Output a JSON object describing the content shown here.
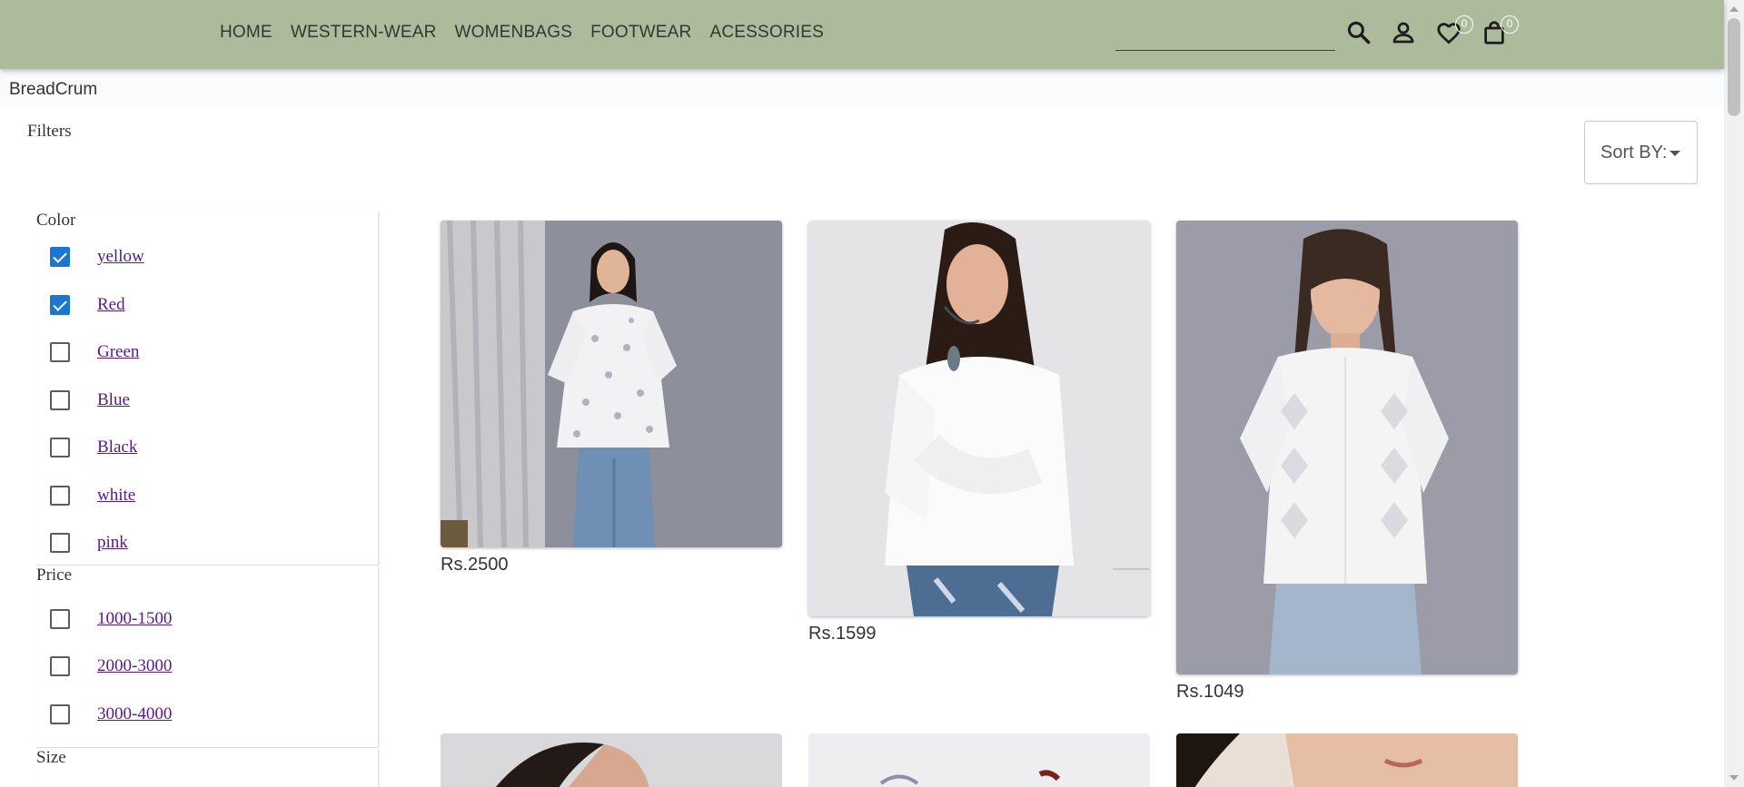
{
  "header": {
    "nav": [
      "HOME",
      "WESTERN-WEAR",
      "WOMENBAGS",
      "FOOTWEAR",
      "ACESSORIES"
    ],
    "search": {
      "placeholder": ""
    },
    "wishlist_count": "0",
    "cart_count": "0",
    "icons": [
      "search-icon",
      "account-icon",
      "heart-icon",
      "shopping-bag-icon"
    ]
  },
  "breadcrumb": "BreadCrum",
  "filters": {
    "title": "Filters",
    "color": {
      "title": "Color",
      "options": [
        {
          "label": "yellow",
          "checked": true
        },
        {
          "label": "Red",
          "checked": true
        },
        {
          "label": "Green",
          "checked": false
        },
        {
          "label": "Blue",
          "checked": false
        },
        {
          "label": "Black",
          "checked": false
        },
        {
          "label": "white",
          "checked": false
        },
        {
          "label": "pink",
          "checked": false
        }
      ]
    },
    "price": {
      "title": "Price",
      "options": [
        {
          "label": "1000-1500",
          "checked": false
        },
        {
          "label": "2000-3000",
          "checked": false
        },
        {
          "label": "3000-4000",
          "checked": false
        }
      ]
    },
    "size": {
      "title": "Size"
    }
  },
  "sort": {
    "label": "Sort BY:"
  },
  "products": [
    {
      "price": "Rs.2500"
    },
    {
      "price": "Rs.1599"
    },
    {
      "price": "Rs.1049"
    }
  ],
  "colors": {
    "header_bg": "#abbb9c",
    "checkbox_checked": "#1976d2",
    "link": "#551a8b"
  }
}
